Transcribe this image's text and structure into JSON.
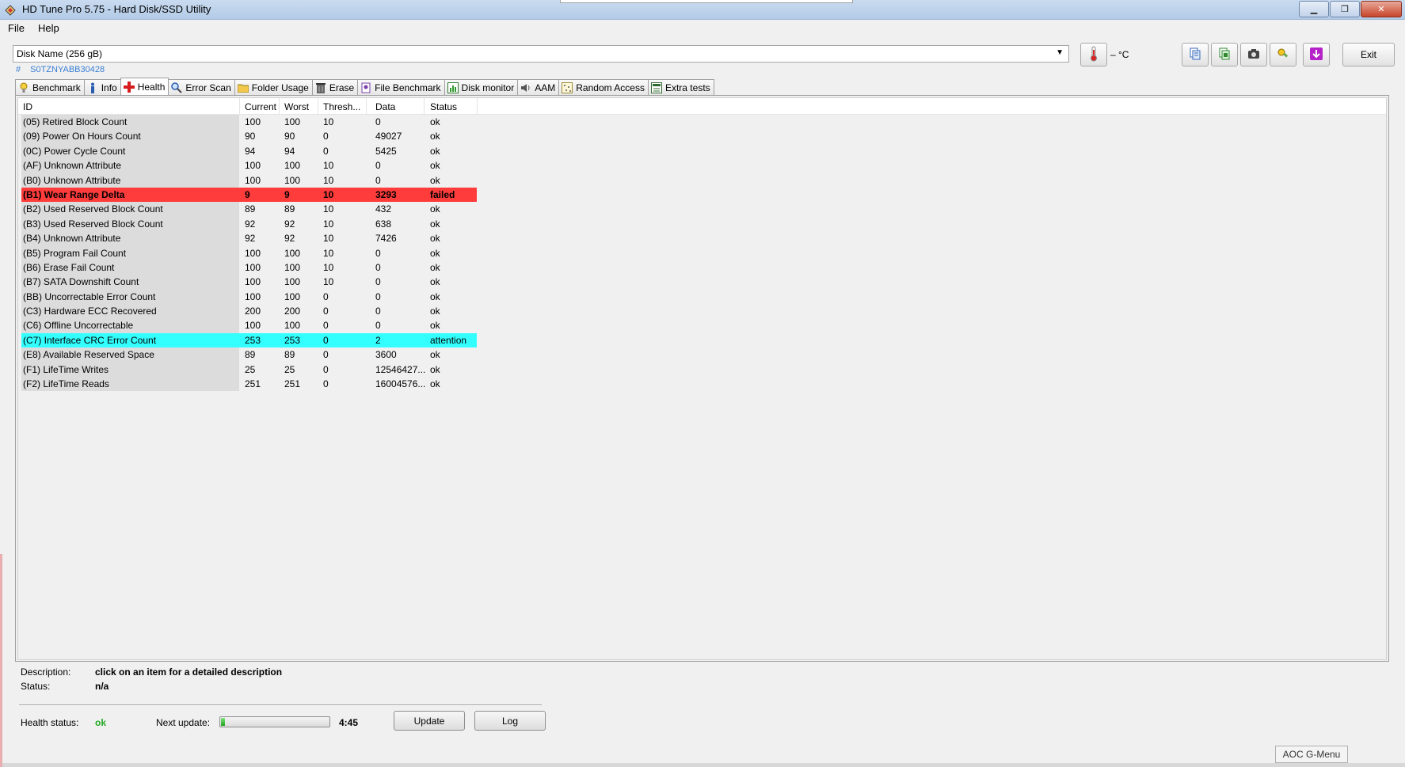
{
  "window": {
    "title": "HD Tune Pro 5.75 - Hard Disk/SSD Utility",
    "controls": [
      "minimize",
      "restore",
      "close"
    ]
  },
  "menu": {
    "file": "File",
    "help": "Help"
  },
  "toolbar": {
    "disk_label": "Disk   Name (256 gB)",
    "serial_hash": "#",
    "serial": "S0TZNYABB30428",
    "temperature": "– °C",
    "exit_label": "Exit",
    "icons": [
      "thermometer-icon",
      "copy-text-icon",
      "copy-screen-icon",
      "screenshot-icon",
      "options-icon",
      "save-icon"
    ]
  },
  "tabs": [
    {
      "label": "Benchmark",
      "icon": "benchmark-icon"
    },
    {
      "label": "Info",
      "icon": "info-icon"
    },
    {
      "label": "Health",
      "icon": "health-cross-icon",
      "active": true
    },
    {
      "label": "Error Scan",
      "icon": "magnifier-icon"
    },
    {
      "label": "Folder Usage",
      "icon": "folder-icon"
    },
    {
      "label": "Erase",
      "icon": "erase-icon"
    },
    {
      "label": "File Benchmark",
      "icon": "file-benchmark-icon"
    },
    {
      "label": "Disk monitor",
      "icon": "disk-monitor-icon"
    },
    {
      "label": "AAM",
      "icon": "speaker-icon"
    },
    {
      "label": "Random Access",
      "icon": "random-access-icon"
    },
    {
      "label": "Extra tests",
      "icon": "extra-tests-icon"
    }
  ],
  "table": {
    "headers": [
      "ID",
      "Current",
      "Worst",
      "Thresh...",
      "Data",
      "Status"
    ],
    "rows": [
      {
        "id": "(05) Retired Block Count",
        "current": "100",
        "worst": "100",
        "thresh": "10",
        "data": "0",
        "status": "ok"
      },
      {
        "id": "(09) Power On Hours Count",
        "current": "90",
        "worst": "90",
        "thresh": "0",
        "data": "49027",
        "status": "ok"
      },
      {
        "id": "(0C) Power Cycle Count",
        "current": "94",
        "worst": "94",
        "thresh": "0",
        "data": "5425",
        "status": "ok"
      },
      {
        "id": "(AF) Unknown Attribute",
        "current": "100",
        "worst": "100",
        "thresh": "10",
        "data": "0",
        "status": "ok"
      },
      {
        "id": "(B0) Unknown Attribute",
        "current": "100",
        "worst": "100",
        "thresh": "10",
        "data": "0",
        "status": "ok"
      },
      {
        "id": "(B1) Wear Range Delta",
        "current": "9",
        "worst": "9",
        "thresh": "10",
        "data": "3293",
        "status": "failed",
        "highlight": "failed"
      },
      {
        "id": "(B2) Used Reserved Block Count",
        "current": "89",
        "worst": "89",
        "thresh": "10",
        "data": "432",
        "status": "ok"
      },
      {
        "id": "(B3) Used Reserved Block Count",
        "current": "92",
        "worst": "92",
        "thresh": "10",
        "data": "638",
        "status": "ok"
      },
      {
        "id": "(B4) Unknown Attribute",
        "current": "92",
        "worst": "92",
        "thresh": "10",
        "data": "7426",
        "status": "ok"
      },
      {
        "id": "(B5) Program Fail Count",
        "current": "100",
        "worst": "100",
        "thresh": "10",
        "data": "0",
        "status": "ok"
      },
      {
        "id": "(B6) Erase Fail Count",
        "current": "100",
        "worst": "100",
        "thresh": "10",
        "data": "0",
        "status": "ok"
      },
      {
        "id": "(B7) SATA Downshift Count",
        "current": "100",
        "worst": "100",
        "thresh": "10",
        "data": "0",
        "status": "ok"
      },
      {
        "id": "(BB) Uncorrectable Error Count",
        "current": "100",
        "worst": "100",
        "thresh": "0",
        "data": "0",
        "status": "ok"
      },
      {
        "id": "(C3) Hardware ECC Recovered",
        "current": "200",
        "worst": "200",
        "thresh": "0",
        "data": "0",
        "status": "ok"
      },
      {
        "id": "(C6) Offline Uncorrectable",
        "current": "100",
        "worst": "100",
        "thresh": "0",
        "data": "0",
        "status": "ok"
      },
      {
        "id": "(C7) Interface CRC Error Count",
        "current": "253",
        "worst": "253",
        "thresh": "0",
        "data": "2",
        "status": "attention",
        "highlight": "attention"
      },
      {
        "id": "(E8) Available Reserved Space",
        "current": "89",
        "worst": "89",
        "thresh": "0",
        "data": "3600",
        "status": "ok"
      },
      {
        "id": "(F1) LifeTime Writes",
        "current": "25",
        "worst": "25",
        "thresh": "0",
        "data": "12546427...",
        "status": "ok"
      },
      {
        "id": "(F2) LifeTime Reads",
        "current": "251",
        "worst": "251",
        "thresh": "0",
        "data": "16004576...",
        "status": "ok"
      }
    ]
  },
  "details": {
    "description_label": "Description:",
    "description_value": "click on an item for a detailed description",
    "status_label": "Status:",
    "status_value": "n/a"
  },
  "health": {
    "label": "Health status:",
    "value": "ok",
    "next_update_label": "Next update:",
    "next_update_time": "4:45",
    "progress_fraction": 0.04,
    "update_button": "Update",
    "log_button": "Log"
  },
  "taskbar": {
    "aoc_label": "AOC G-Menu"
  },
  "colors": {
    "failed_row": "#ff3c3c",
    "attention_row": "#33ffff",
    "ok_status": "#22aa22",
    "serial_text": "#3b7fd4"
  }
}
